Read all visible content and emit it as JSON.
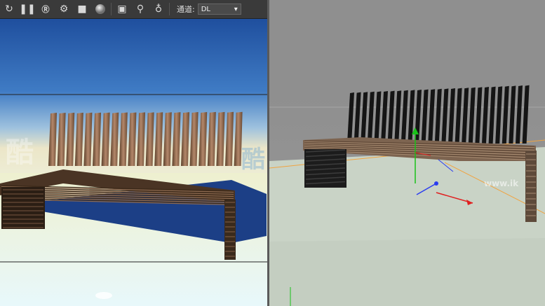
{
  "toolbar": {
    "icons": [
      "refresh-icon",
      "pause-icon",
      "render-region-icon",
      "settings-icon",
      "lock-icon",
      "sphere-icon",
      "frame-icon",
      "pin-icon",
      "pin-alt-icon"
    ],
    "channel_label": "通道:",
    "channel_value": "DL"
  },
  "watermark": {
    "brand": "酷",
    "url": "www.ik"
  },
  "colors": {
    "toolbar_bg": "#3a3a3a",
    "sky_top": "#1f4f9e",
    "sky_bottom": "#f4f0d8",
    "viewport_bg": "#8d8d8d",
    "floor": "#c9d3c6",
    "axis_x": "#e02020",
    "axis_y": "#19c219",
    "axis_z": "#2a3cf0"
  }
}
